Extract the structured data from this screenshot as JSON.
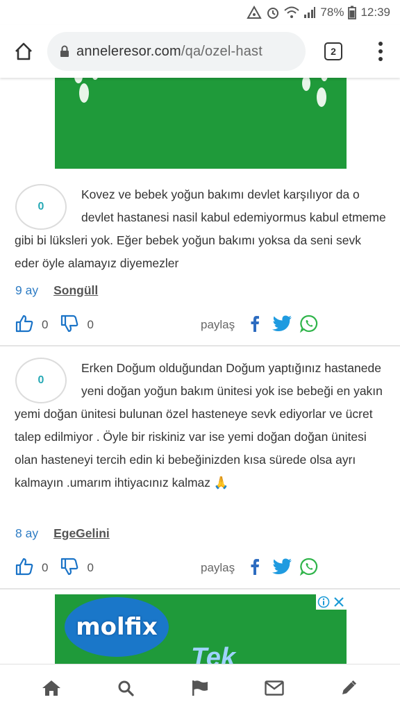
{
  "status_bar": {
    "battery": "78%",
    "time": "12:39"
  },
  "browser": {
    "url_domain": "anneleresor.com",
    "url_path": "/qa/ozel-hast",
    "tab_count": "2"
  },
  "comments": [
    {
      "votes": "0",
      "text": "Kovez ve bebek yoğun bakımı devlet karşılıyor da o devlet hastanesi nasil kabul edemiyormus kabul etmeme gibi bi lüksleri yok. Eğer bebek yoğun bakımı yoksa da seni sevk eder öyle alamayız diyemezler",
      "ago": "9 ay",
      "author": "Songüll",
      "likes": "0",
      "dislikes": "0",
      "share_label": "paylaş"
    },
    {
      "votes": "0",
      "text": "Erken Doğum olduğundan Doğum yaptığınız hastanede yeni doğan yoğun bakım ünitesi yok ise bebeği en yakın yemi doğan ünitesi bulunan özel hasteneye sevk ediyorlar ve ücret talep edilmiyor . Öyle bir riskiniz var ise yemi doğan doğan ünitesi olan hasteneyi tercih edin ki bebeğinizden kısa sürede olsa ayrı kalmayın .umarım ihtiyacınız kalmaz 🙏",
      "ago": "8 ay",
      "author": "EgeGelini",
      "likes": "0",
      "dislikes": "0",
      "share_label": "paylaş"
    }
  ],
  "ad_bottom": {
    "brand": "molfix",
    "tagline": "Tek"
  },
  "bottom_nav": [
    "home-icon",
    "search-icon",
    "flag-icon",
    "mail-icon",
    "pencil-icon"
  ]
}
